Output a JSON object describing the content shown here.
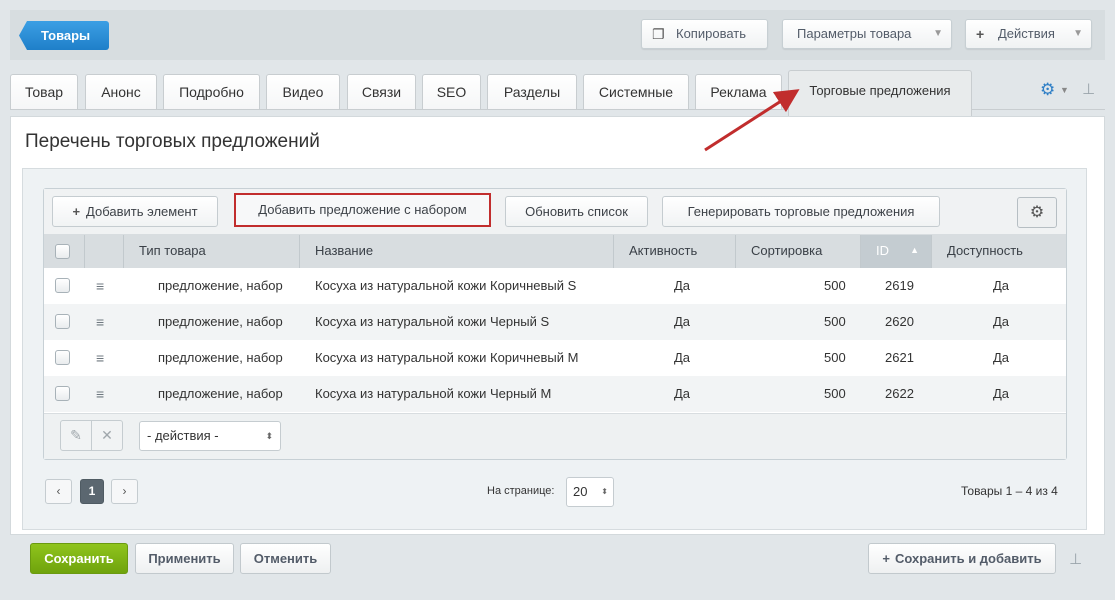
{
  "header": {
    "back_label": "Товары",
    "copy_label": "Копировать",
    "params_label": "Параметры товара",
    "actions_label": "Действия"
  },
  "tabs": [
    {
      "label": "Товар"
    },
    {
      "label": "Анонс"
    },
    {
      "label": "Подробно"
    },
    {
      "label": "Видео"
    },
    {
      "label": "Связи"
    },
    {
      "label": "SEO"
    },
    {
      "label": "Разделы"
    },
    {
      "label": "Системные"
    },
    {
      "label": "Реклама"
    },
    {
      "label": "Торговые предложения",
      "active": true
    }
  ],
  "section_title": "Перечень торговых предложений",
  "toolbar": {
    "add_element": "Добавить элемент",
    "add_offer_set": "Добавить предложение с набором",
    "refresh_list": "Обновить список",
    "generate_offers": "Генерировать торговые предложения"
  },
  "table": {
    "columns": [
      "Тип товара",
      "Название",
      "Активность",
      "Сортировка",
      "ID",
      "Доступность"
    ],
    "sorted_column": "ID",
    "rows": [
      {
        "type": "предложение, набор",
        "name": "Косуха из натуральной кожи Коричневый S",
        "active": "Да",
        "sort": "500",
        "id": "2619",
        "available": "Да"
      },
      {
        "type": "предложение, набор",
        "name": "Косуха из натуральной кожи Черный S",
        "active": "Да",
        "sort": "500",
        "id": "2620",
        "available": "Да"
      },
      {
        "type": "предложение, набор",
        "name": "Косуха из натуральной кожи Коричневый M",
        "active": "Да",
        "sort": "500",
        "id": "2621",
        "available": "Да"
      },
      {
        "type": "предложение, набор",
        "name": "Косуха из натуральной кожи Черный M",
        "active": "Да",
        "sort": "500",
        "id": "2622",
        "available": "Да"
      }
    ]
  },
  "bulk_actions": {
    "select_value": "- действия -"
  },
  "pager": {
    "prev": "‹",
    "current": "1",
    "next": "›",
    "per_page_label": "На странице:",
    "per_page_value": "20",
    "total_text": "Товары 1 – 4 из 4"
  },
  "footer": {
    "save": "Сохранить",
    "apply": "Применить",
    "cancel": "Отменить",
    "save_add": "Сохранить и добавить"
  },
  "colors": {
    "accent_blue": "#2b8ed8",
    "save_green": "#7cb413",
    "highlight_red": "#c12d2d"
  }
}
